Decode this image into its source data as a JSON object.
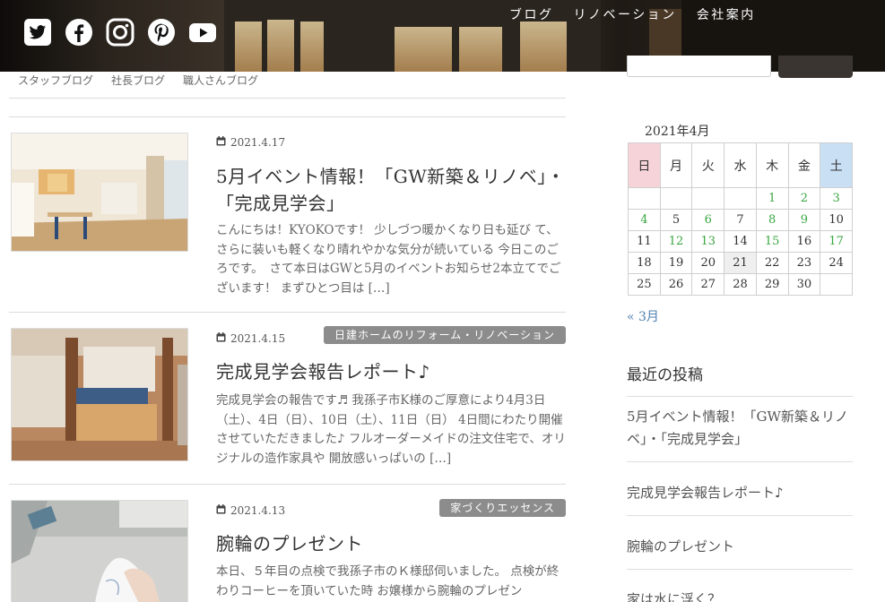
{
  "social": {
    "icons": [
      "twitter-icon",
      "facebook-icon",
      "instagram-icon",
      "pinterest-icon",
      "youtube-icon"
    ]
  },
  "nav": {
    "items": [
      "ブログ",
      "リノベーション",
      "会社案内"
    ]
  },
  "subnav": {
    "items": [
      "スタッフブログ",
      "社長ブログ",
      "職人さんブログ"
    ]
  },
  "posts": [
    {
      "date": "2021.4.17",
      "category": "",
      "title": "5月イベント情報！「GW新築＆リノベ」・「完成見学会」",
      "excerpt": "こんにちは！KYOKOです！ 少しづつ暖かくなり日も延び て、さらに装いも軽くなり晴れやかな気分が続いている 今日このごろです。　さて本日はGWと5月のイベントお知らせ2本立てでございます！ まずひとつ目は […]"
    },
    {
      "date": "2021.4.15",
      "category": "日建ホームのリフォーム・リノベーション",
      "title": "完成見学会報告レポート♪",
      "excerpt": "完成見学会の報告です♬ 我孫子市K様のご厚意により4月3日（土）、4日（日）、10日（土）、11日（日） 4日間にわたり開催させていただきました♪ フルオーダーメイドの注文住宅で、オリジナルの造作家具や 開放感いっぱいの […]"
    },
    {
      "date": "2021.4.13",
      "category": "家づくりエッセンス",
      "title": "腕輪のプレゼント",
      "excerpt": "本日、５年目の点検で我孫子市のＫ様邸伺いました。 点検が終わりコーヒーを頂いていた時 お嬢様から腕輪のプレゼン"
    }
  ],
  "calendar": {
    "caption": "2021年4月",
    "weekdays": [
      "日",
      "月",
      "火",
      "水",
      "木",
      "金",
      "土"
    ],
    "rows": [
      [
        "",
        "",
        "",
        "",
        "1",
        "2",
        "3"
      ],
      [
        "4",
        "5",
        "6",
        "7",
        "8",
        "9",
        "10"
      ],
      [
        "11",
        "12",
        "13",
        "14",
        "15",
        "16",
        "17"
      ],
      [
        "18",
        "19",
        "20",
        "21",
        "22",
        "23",
        "24"
      ],
      [
        "25",
        "26",
        "27",
        "28",
        "29",
        "30",
        ""
      ]
    ],
    "linked_days": [
      "1",
      "2",
      "3",
      "4",
      "6",
      "8",
      "9",
      "12",
      "13",
      "15",
      "17"
    ],
    "today": "21",
    "prev_link": "« 3月"
  },
  "recent": {
    "heading": "最近の投稿",
    "items": [
      "5月イベント情報！「GW新築＆リノベ」・「完成見学会」",
      "完成見学会報告レポート♪",
      "腕輪のプレゼント",
      "家は水に浮く？"
    ]
  },
  "colors": {
    "accent_link": "#4d7fb0",
    "calendar_link": "#3aa640",
    "category_badge": "#8c8c8c",
    "sunday_header": "#f6d3d8",
    "saturday_header": "#c9dff4"
  }
}
